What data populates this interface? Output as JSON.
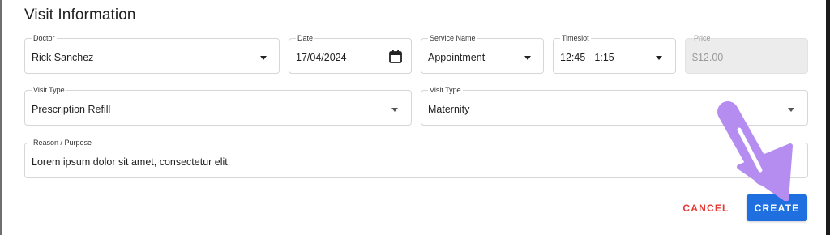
{
  "header": {
    "title": "Visit Information"
  },
  "fields": {
    "doctor": {
      "label": "Doctor",
      "value": "Rick Sanchez"
    },
    "date": {
      "label": "Date",
      "value": "17/04/2024"
    },
    "service": {
      "label": "Service Name",
      "value": "Appointment"
    },
    "timeslot": {
      "label": "Timeslot",
      "value": "12:45 - 1:15"
    },
    "price": {
      "label": "Price",
      "value": "$12.00"
    },
    "visit_type_1": {
      "label": "Visit Type",
      "value": "Prescription Refill"
    },
    "visit_type_2": {
      "label": "Visit Type",
      "value": "Maternity"
    },
    "reason": {
      "label": "Reason / Purpose",
      "value": "Lorem ipsum dolor sit amet, consectetur elit."
    }
  },
  "actions": {
    "cancel_label": "CANCEL",
    "create_label": "CREATE"
  },
  "colors": {
    "primary": "#1f6fe0",
    "cancel": "#e53935",
    "annotation_arrow": "#b58cf0"
  },
  "icons": [
    "calendar-icon",
    "chevron-down-icon",
    "annotation-arrow-icon"
  ]
}
